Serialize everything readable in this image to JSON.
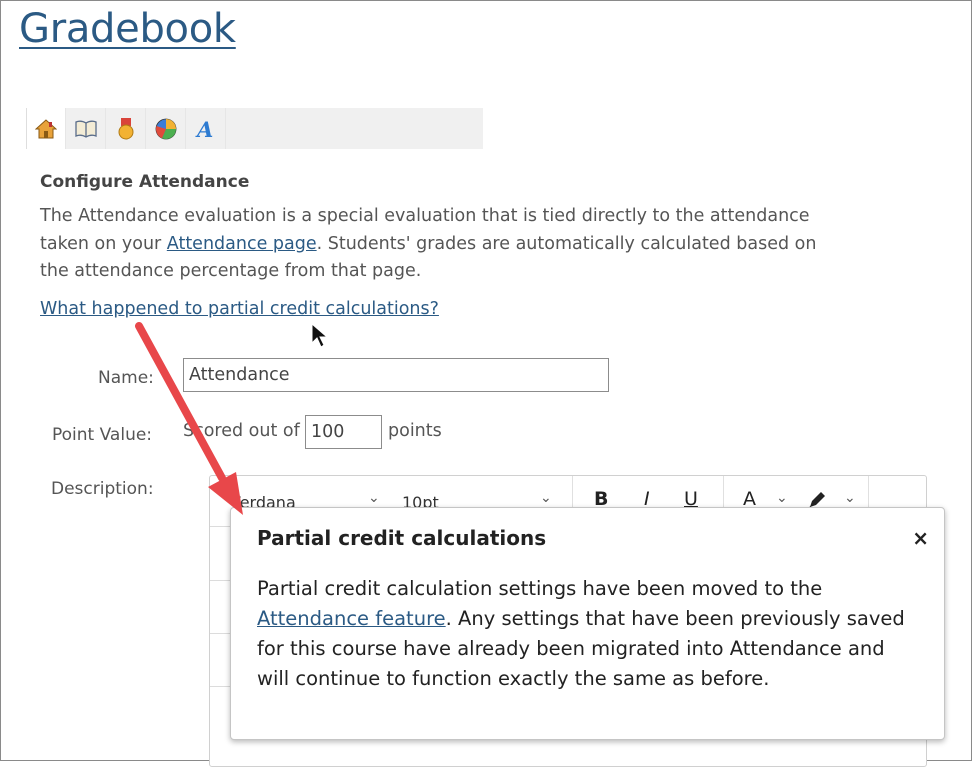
{
  "page": {
    "title": "Gradebook"
  },
  "toolbar": {
    "buttons": [
      {
        "icon": "home-icon"
      },
      {
        "icon": "book-icon"
      },
      {
        "icon": "medal-icon"
      },
      {
        "icon": "pie-chart-icon"
      },
      {
        "icon": "font-icon"
      }
    ]
  },
  "section": {
    "heading": "Configure Attendance",
    "intro_before": "The Attendance evaluation is a special evaluation that is tied directly to the attendance taken on your ",
    "intro_link": "Attendance page",
    "intro_after": ". Students' grades are automatically calculated based on the attendance percentage from that page.",
    "help_link": "What happened to partial credit calculations?"
  },
  "form": {
    "name_label": "Name:",
    "name_value": "Attendance",
    "point_label": "Point Value:",
    "scored_prefix": "Scored out of",
    "points_value": "100",
    "points_suffix": "points",
    "description_label": "Description:"
  },
  "editor": {
    "font": "Verdana",
    "size": "10pt",
    "bold": "B",
    "italic": "I",
    "underline": "U",
    "font_color": "A",
    "chevron": "⌄"
  },
  "popup": {
    "title": "Partial credit calculations",
    "close": "×",
    "body_before": "Partial credit calculation settings have been moved to the ",
    "body_link": "Attendance feature",
    "body_after": ". Any settings that have been previously saved for this course have already been migrated into Attendance and will continue to function exactly the same as before."
  },
  "colors": {
    "link": "#2b5a84",
    "annotation_arrow": "#e8474a"
  }
}
